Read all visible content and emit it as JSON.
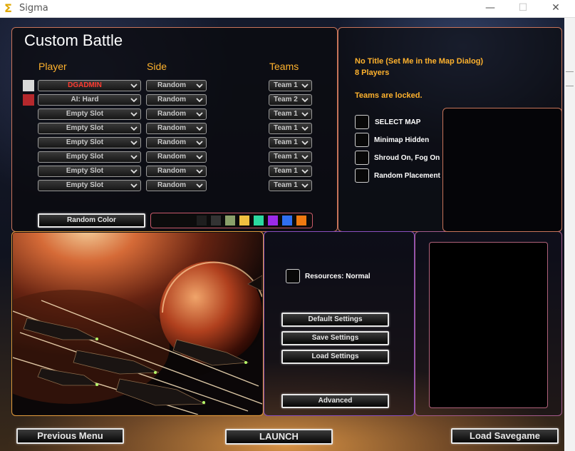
{
  "window": {
    "title": "Sigma",
    "controls": [
      "—",
      "☐",
      "✕"
    ]
  },
  "screen": {
    "title": "Custom Battle"
  },
  "columns": {
    "player": "Player",
    "side": "Side",
    "teams": "Teams"
  },
  "slots": [
    {
      "color": "#d9d9d9",
      "player": "DGADMIN",
      "side": "Random",
      "team": "Team 1",
      "highlight": true
    },
    {
      "color": "#b5282c",
      "player": "AI: Hard",
      "side": "Random",
      "team": "Team 2"
    },
    {
      "player": "Empty Slot",
      "side": "Random",
      "team": "Team 1"
    },
    {
      "player": "Empty Slot",
      "side": "Random",
      "team": "Team 1"
    },
    {
      "player": "Empty Slot",
      "side": "Random",
      "team": "Team 1"
    },
    {
      "player": "Empty Slot",
      "side": "Random",
      "team": "Team 1"
    },
    {
      "player": "Empty Slot",
      "side": "Random",
      "team": "Team 1"
    },
    {
      "player": "Empty Slot",
      "side": "Random",
      "team": "Team 1"
    }
  ],
  "random_color_label": "Random Color",
  "palette": [
    "#1e1e1e",
    "#333333",
    "#8aa06a",
    "#f0c040",
    "#2bd9a0",
    "#9b2ae8",
    "#2f6ff0",
    "#f07a10"
  ],
  "map_info": {
    "title": "No Title (Set Me in the Map Dialog)",
    "players": "8 Players",
    "teams_locked": "Teams are locked."
  },
  "options": [
    {
      "label": "SELECT MAP"
    },
    {
      "label": "Minimap Hidden"
    },
    {
      "label": "Shroud On, Fog On"
    },
    {
      "label": "Random Placement"
    }
  ],
  "resources_label": "Resources: Normal",
  "settings_buttons": {
    "default": "Default Settings",
    "save": "Save Settings",
    "load": "Load Settings",
    "advanced": "Advanced"
  },
  "bottom_buttons": {
    "previous": "Previous Menu",
    "launch": "LAUNCH",
    "load_savegame": "Load Savegame"
  },
  "colors": {
    "accent": "#ffb22d",
    "panel_border": "#c8745a",
    "highlight_text": "#ff3b30"
  },
  "icons": {
    "app": "sigma-icon",
    "dropdown": "chevron-down-icon"
  }
}
